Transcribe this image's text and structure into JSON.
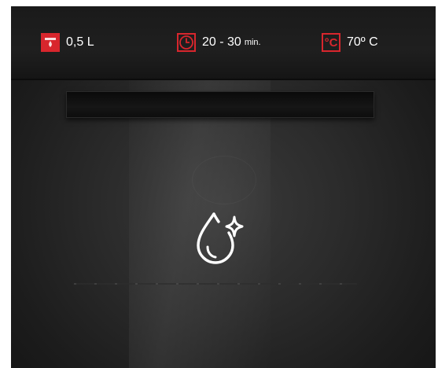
{
  "specs": {
    "water": {
      "icon": "water-tray-icon",
      "value": "0,5 L"
    },
    "time": {
      "icon": "clock-icon",
      "value": "20 - 30",
      "unit": "min."
    },
    "temperature": {
      "icon": "celsius-icon",
      "glyph": "°C",
      "value": "70º C"
    }
  },
  "feature_icon": "steam-clean-drop-icon",
  "colors": {
    "accent": "#d8262d",
    "text": "#ffffff",
    "background": "#1e1e1e"
  }
}
